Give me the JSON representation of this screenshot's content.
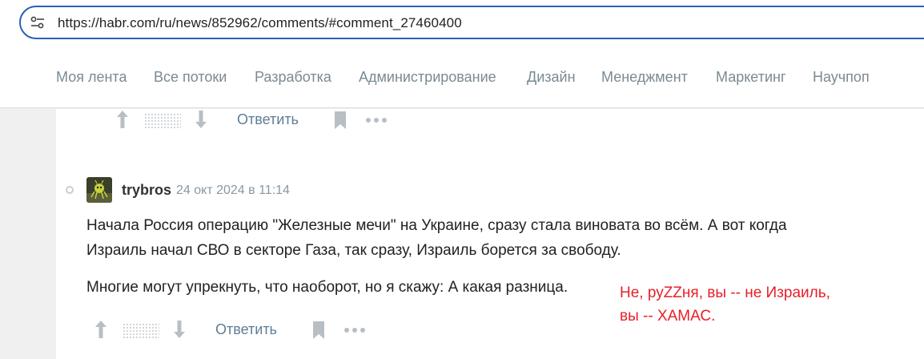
{
  "browser": {
    "url": "https://habr.com/ru/news/852962/comments/#comment_27460400",
    "site_info_icon": "tune-icon"
  },
  "nav": {
    "items": [
      "Моя лента",
      "Все потоки",
      "Разработка",
      "Администрирование",
      "Дизайн",
      "Менеджмент",
      "Маркетинг",
      "Научпоп"
    ]
  },
  "prev_comment_actions": {
    "reply_label": "Ответить"
  },
  "comment": {
    "username": "trybros",
    "timestamp": "24 окт 2024 в 11:14",
    "paragraph1_line1": "Начала Россия операцию \"Железные мечи\" на Украине, сразу стала виновата во всём. А вот когда",
    "paragraph1_line2": "Израиль начал СВО в секторе Газа, так сразу, Израиль борется за свободу.",
    "paragraph2": "Многие могут упрекнуть, что наоборот, но я скажу: А какая разница.",
    "reply_label": "Ответить"
  },
  "annotation": {
    "line1": "Не, руZZня, вы -- не Израиль,",
    "line2": "вы -- ХАМАС.",
    "color": "#e8202a"
  },
  "colors": {
    "accent_border": "#2b5fb8",
    "link": "#5e7d95",
    "nav_text": "#7a8a93"
  }
}
